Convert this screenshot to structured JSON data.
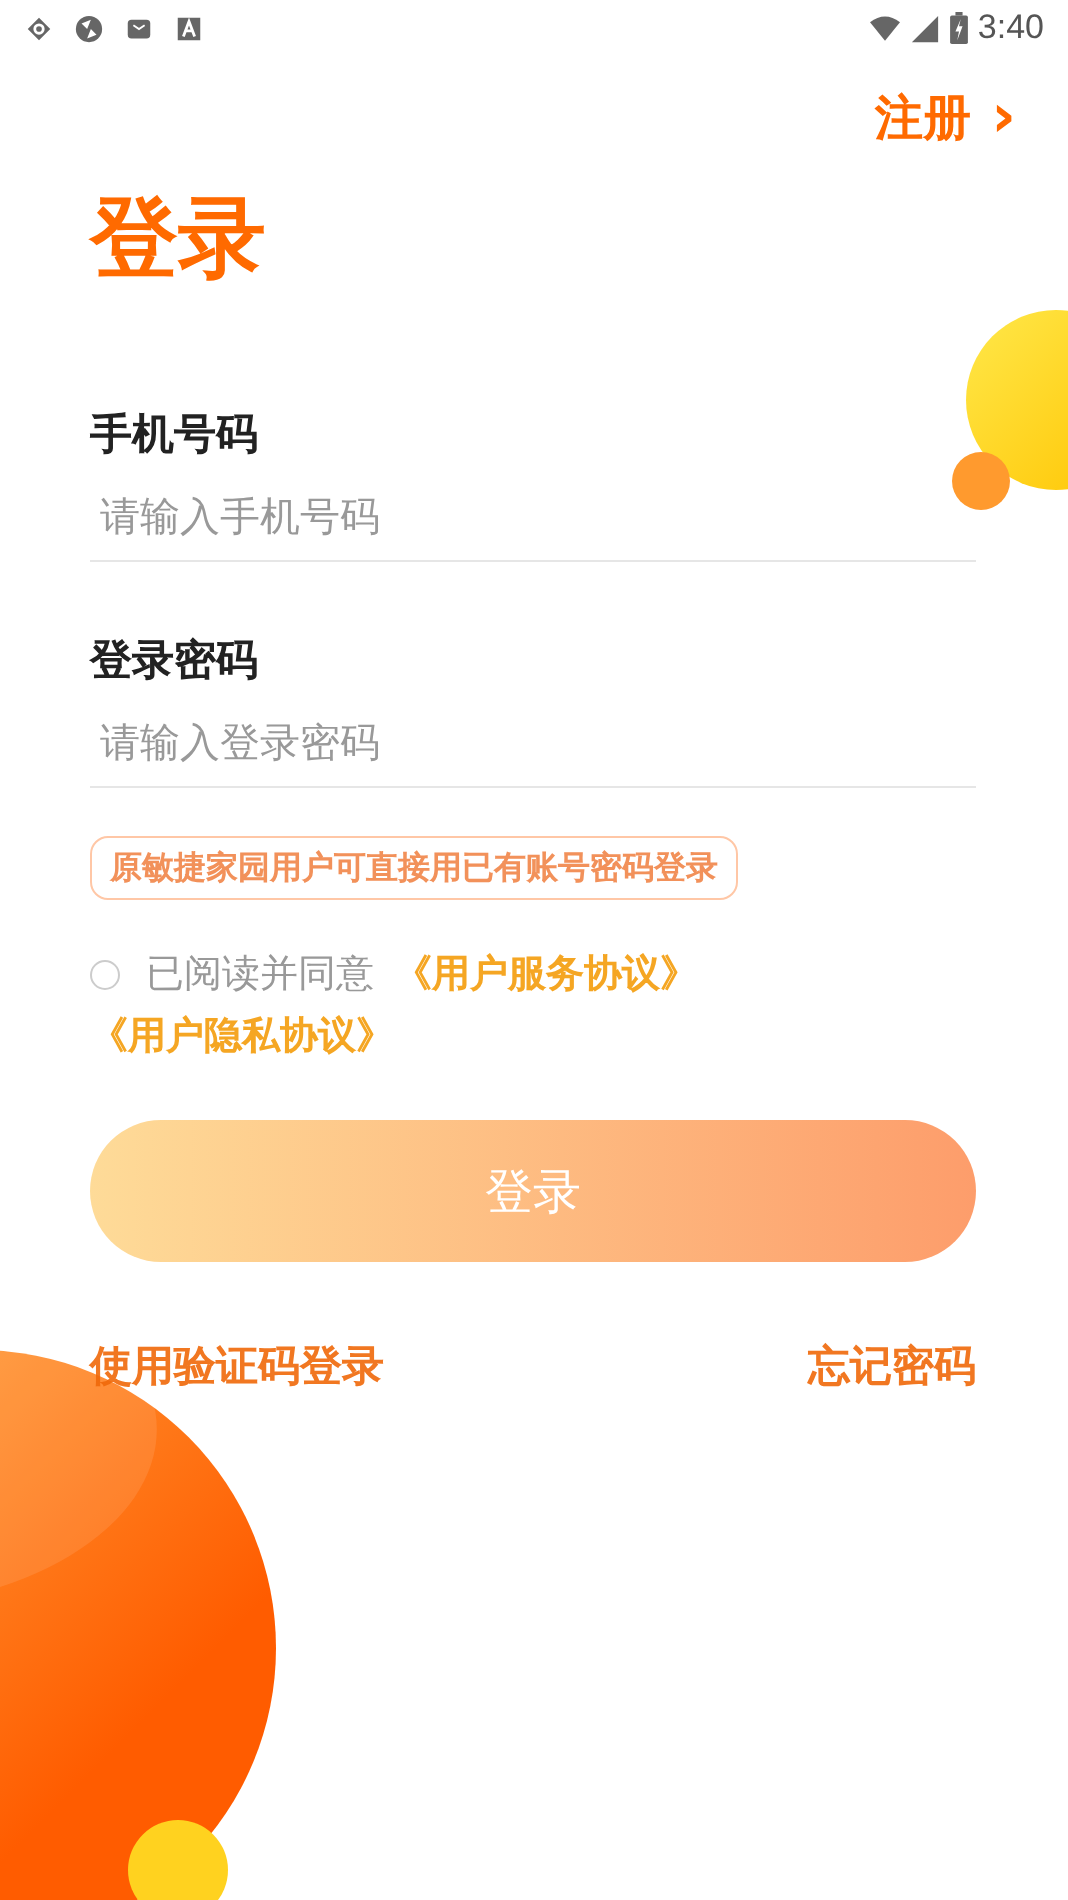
{
  "status_bar": {
    "time": "3:40"
  },
  "register_link": {
    "label": "注册",
    "chevron": "›"
  },
  "title": "登录",
  "fields": [
    {
      "label": "手机号码",
      "placeholder": "请输入手机号码"
    },
    {
      "label": "登录密码",
      "placeholder": "请输入登录密码"
    }
  ],
  "notice": "原敏捷家园用户可直接用已有账号密码登录",
  "agreement": {
    "checked": false,
    "text": "已阅读并同意",
    "links": [
      "《用户服务协议》",
      "《用户隐私协议》"
    ]
  },
  "login_button": "登录",
  "bottom_links": [
    "使用验证码登录",
    "忘记密码"
  ]
}
